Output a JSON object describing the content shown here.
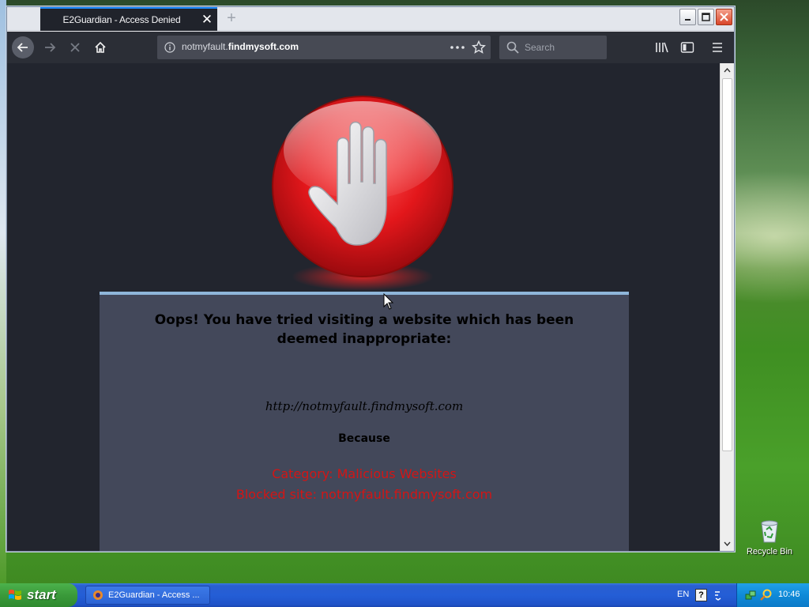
{
  "browser": {
    "tab_title": "E2Guardian - Access Denied",
    "url_domain_prefix": "notmyfault.",
    "url_domain_main": "findmysoft.com",
    "search_placeholder": "Search"
  },
  "page": {
    "heading": "Oops! You have tried visiting a website which has been deemed inappropriate:",
    "blocked_url": "http://notmyfault.findmysoft.com",
    "because_label": "Because",
    "category_line": "Category: Malicious Websites",
    "blocked_site_line": "Blocked site: notmyfault.findmysoft.com"
  },
  "desktop": {
    "recycle_bin_label": "Recycle Bin"
  },
  "taskbar": {
    "start_label": "start",
    "task_item_label": "E2Guardian - Access ...",
    "language": "EN",
    "help_label": "?",
    "clock": "10:46"
  },
  "colors": {
    "page_background": "#22252e",
    "panel_background": "#43485a",
    "panel_top_border": "#8fb6da",
    "reason_text": "#d31515",
    "toolbar": "#2b2e36",
    "tab_accent": "#1b8bff"
  },
  "icons": [
    "back-arrow-icon",
    "forward-arrow-icon",
    "stop-loading-icon",
    "home-icon",
    "site-info-icon",
    "page-actions-icon",
    "bookmark-star-icon",
    "search-icon",
    "library-icon",
    "sidebar-icon",
    "menu-icon",
    "stop-hand-icon",
    "recycle-bin-icon",
    "windows-flag-icon"
  ]
}
